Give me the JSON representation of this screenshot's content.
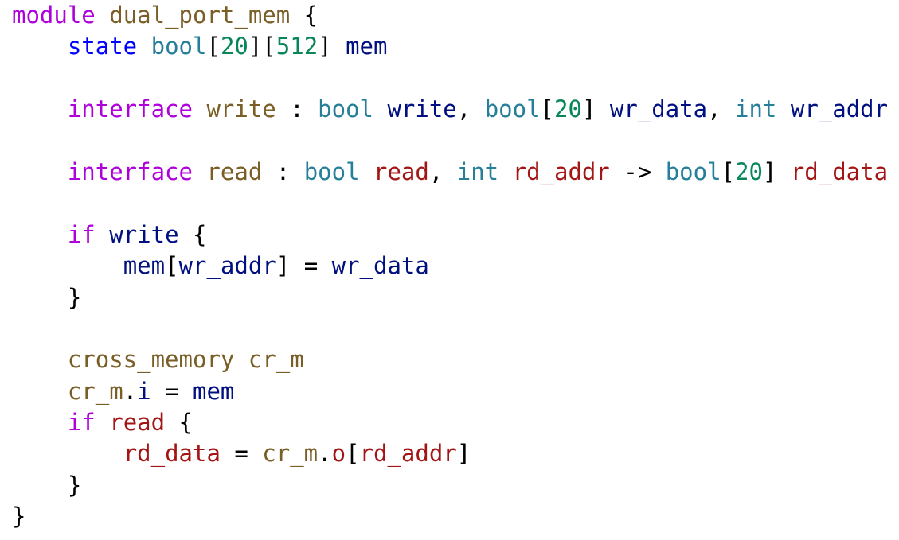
{
  "editor": {
    "language": "sus",
    "colors": {
      "keyword": "#af00db",
      "module_name": "#795e26",
      "state_keyword": "#0000ff",
      "type": "#267f99",
      "number": "#098658",
      "variable": "#001080",
      "read_variable": "#a31515",
      "punctuation": "#000000"
    },
    "lines": [
      [
        {
          "c": "kw",
          "t": "module"
        },
        {
          "c": "plain",
          "t": " "
        },
        {
          "c": "modname",
          "t": "dual_port_mem"
        },
        {
          "c": "plain",
          "t": " {"
        }
      ],
      [
        {
          "c": "plain",
          "t": "    "
        },
        {
          "c": "state",
          "t": "state"
        },
        {
          "c": "plain",
          "t": " "
        },
        {
          "c": "type",
          "t": "bool"
        },
        {
          "c": "punct",
          "t": "["
        },
        {
          "c": "num",
          "t": "20"
        },
        {
          "c": "punct",
          "t": "]["
        },
        {
          "c": "num",
          "t": "512"
        },
        {
          "c": "punct",
          "t": "] "
        },
        {
          "c": "var",
          "t": "mem"
        }
      ],
      [],
      [
        {
          "c": "plain",
          "t": "    "
        },
        {
          "c": "kw",
          "t": "interface"
        },
        {
          "c": "plain",
          "t": " "
        },
        {
          "c": "modname",
          "t": "write"
        },
        {
          "c": "plain",
          "t": " : "
        },
        {
          "c": "type",
          "t": "bool"
        },
        {
          "c": "plain",
          "t": " "
        },
        {
          "c": "var",
          "t": "write"
        },
        {
          "c": "plain",
          "t": ", "
        },
        {
          "c": "type",
          "t": "bool"
        },
        {
          "c": "punct",
          "t": "["
        },
        {
          "c": "num",
          "t": "20"
        },
        {
          "c": "punct",
          "t": "] "
        },
        {
          "c": "var",
          "t": "wr_data"
        },
        {
          "c": "plain",
          "t": ", "
        },
        {
          "c": "type",
          "t": "int"
        },
        {
          "c": "plain",
          "t": " "
        },
        {
          "c": "var",
          "t": "wr_addr"
        }
      ],
      [],
      [
        {
          "c": "plain",
          "t": "    "
        },
        {
          "c": "kw",
          "t": "interface"
        },
        {
          "c": "plain",
          "t": " "
        },
        {
          "c": "modname",
          "t": "read"
        },
        {
          "c": "plain",
          "t": " : "
        },
        {
          "c": "type",
          "t": "bool"
        },
        {
          "c": "plain",
          "t": " "
        },
        {
          "c": "read",
          "t": "read"
        },
        {
          "c": "plain",
          "t": ", "
        },
        {
          "c": "type",
          "t": "int"
        },
        {
          "c": "plain",
          "t": " "
        },
        {
          "c": "read",
          "t": "rd_addr"
        },
        {
          "c": "plain",
          "t": " -> "
        },
        {
          "c": "type",
          "t": "bool"
        },
        {
          "c": "punct",
          "t": "["
        },
        {
          "c": "num",
          "t": "20"
        },
        {
          "c": "punct",
          "t": "] "
        },
        {
          "c": "read",
          "t": "rd_data"
        }
      ],
      [],
      [
        {
          "c": "plain",
          "t": "    "
        },
        {
          "c": "kw",
          "t": "if"
        },
        {
          "c": "plain",
          "t": " "
        },
        {
          "c": "var",
          "t": "write"
        },
        {
          "c": "plain",
          "t": " {"
        }
      ],
      [
        {
          "c": "plain",
          "t": "        "
        },
        {
          "c": "var",
          "t": "mem"
        },
        {
          "c": "punct",
          "t": "["
        },
        {
          "c": "var",
          "t": "wr_addr"
        },
        {
          "c": "punct",
          "t": "]"
        },
        {
          "c": "plain",
          "t": " = "
        },
        {
          "c": "var",
          "t": "wr_data"
        }
      ],
      [
        {
          "c": "plain",
          "t": "    }"
        }
      ],
      [],
      [
        {
          "c": "plain",
          "t": "    "
        },
        {
          "c": "modname",
          "t": "cross_memory"
        },
        {
          "c": "plain",
          "t": " "
        },
        {
          "c": "modname",
          "t": "cr_m"
        }
      ],
      [
        {
          "c": "plain",
          "t": "    "
        },
        {
          "c": "modname",
          "t": "cr_m"
        },
        {
          "c": "plain",
          "t": "."
        },
        {
          "c": "var",
          "t": "i"
        },
        {
          "c": "plain",
          "t": " = "
        },
        {
          "c": "var",
          "t": "mem"
        }
      ],
      [
        {
          "c": "plain",
          "t": "    "
        },
        {
          "c": "kw",
          "t": "if"
        },
        {
          "c": "plain",
          "t": " "
        },
        {
          "c": "read",
          "t": "read"
        },
        {
          "c": "plain",
          "t": " {"
        }
      ],
      [
        {
          "c": "plain",
          "t": "        "
        },
        {
          "c": "read",
          "t": "rd_data"
        },
        {
          "c": "plain",
          "t": " = "
        },
        {
          "c": "modname",
          "t": "cr_m"
        },
        {
          "c": "plain",
          "t": "."
        },
        {
          "c": "read",
          "t": "o"
        },
        {
          "c": "punct",
          "t": "["
        },
        {
          "c": "read",
          "t": "rd_addr"
        },
        {
          "c": "punct",
          "t": "]"
        }
      ],
      [
        {
          "c": "plain",
          "t": "    }"
        }
      ],
      [
        {
          "c": "plain",
          "t": "}"
        }
      ]
    ]
  }
}
